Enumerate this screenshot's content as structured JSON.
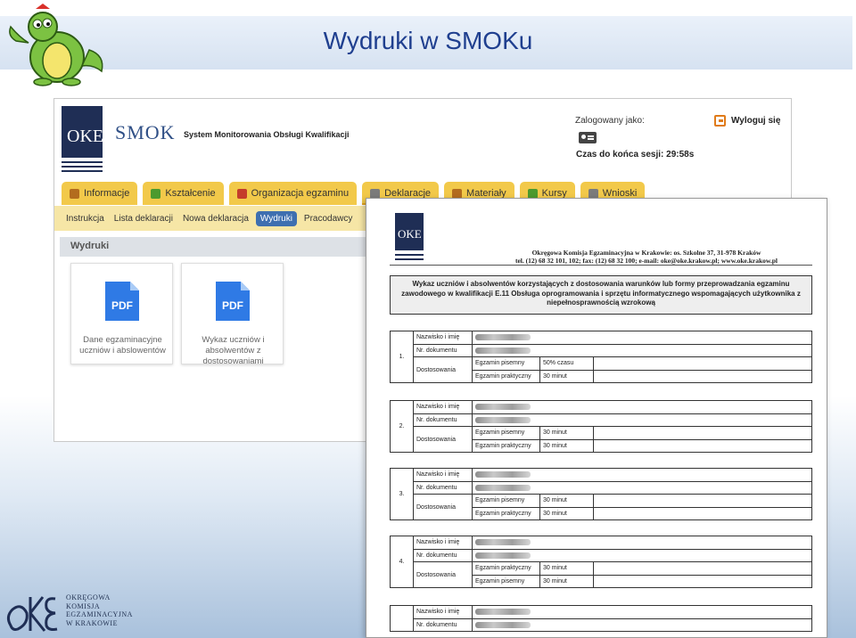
{
  "slide": {
    "title": "Wydruki w SMOKu"
  },
  "smok": {
    "app_name": "SMOK",
    "app_description": "System Monitorowania Obsługi Kwalifikacji",
    "logged_label": "Zalogowany jako:",
    "session_label": "Czas do końca sesji:",
    "session_time": "29:58s",
    "logout_label": "Wyloguj się",
    "tabs": [
      {
        "label": "Informacje",
        "icon": "home-icon"
      },
      {
        "label": "Kształcenie",
        "icon": "tree-icon"
      },
      {
        "label": "Organizacja egzaminu",
        "icon": "calendar-icon"
      },
      {
        "label": "Deklaracje",
        "icon": "edit-icon"
      },
      {
        "label": "Materiały",
        "icon": "package-icon"
      },
      {
        "label": "Kursy",
        "icon": "tree-icon"
      },
      {
        "label": "Wnioski",
        "icon": "document-icon"
      }
    ],
    "subnav": [
      "Instrukcja",
      "Lista deklaracji",
      "Nowa deklaracja",
      "Wydruki",
      "Pracodawcy"
    ],
    "active_subnav": "Wydruki",
    "section_title": "Wydruki",
    "cards": [
      {
        "icon": "pdf-icon",
        "label": "Dane egzaminacyjne uczniów i abslowentów"
      },
      {
        "icon": "pdf-icon",
        "label": "Wykaz uczniów i absolwentów z dostosowaniami"
      }
    ]
  },
  "document": {
    "header_line1": "Okręgowa Komisja Egzaminacyjna w Krakowie: os. Szkolne 37, 31-978 Kraków",
    "header_line2": "tel. (12) 68 32 101, 102; fax: (12) 68 32 100; e-mail: oke@oke.krakow.pl; www.oke.krakow.pl",
    "title": "Wykaz uczniów i absolwentów korzystających z dostosowania warunków lub formy przeprowadzania egzaminu zawodowego w kwalifikacji E.11 Obsługa oprogramowania i sprzętu informatycznego wspomagających użytkownika z niepełnosprawnością wzrokową",
    "labels": {
      "name": "Nazwisko i imię",
      "doc": "Nr. dokumentu",
      "adapt": "Dostosowania",
      "written": "Egzamin pisemny",
      "practical": "Egzamin praktyczny"
    },
    "students": [
      {
        "num": "1.",
        "exams": [
          {
            "type": "Egzamin pisemny",
            "value": "50% czasu"
          },
          {
            "type": "Egzamin praktyczny",
            "value": "30 minut"
          }
        ]
      },
      {
        "num": "2.",
        "exams": [
          {
            "type": "Egzamin pisemny",
            "value": "30 minut"
          },
          {
            "type": "Egzamin praktyczny",
            "value": "30 minut"
          }
        ]
      },
      {
        "num": "3.",
        "exams": [
          {
            "type": "Egzamin pisemny",
            "value": "30 minut"
          },
          {
            "type": "Egzamin praktyczny",
            "value": "30 minut"
          }
        ]
      },
      {
        "num": "4.",
        "exams": [
          {
            "type": "Egzamin praktyczny",
            "value": "30 minut"
          },
          {
            "type": "Egzamin pisemny",
            "value": "30 minut"
          }
        ]
      },
      {
        "num": "",
        "exams": []
      }
    ]
  },
  "footer": {
    "org_lines": [
      "OKRĘGOWA",
      "KOMISJA",
      "EGZAMINACYJNA",
      "W KRAKOWIE"
    ]
  }
}
